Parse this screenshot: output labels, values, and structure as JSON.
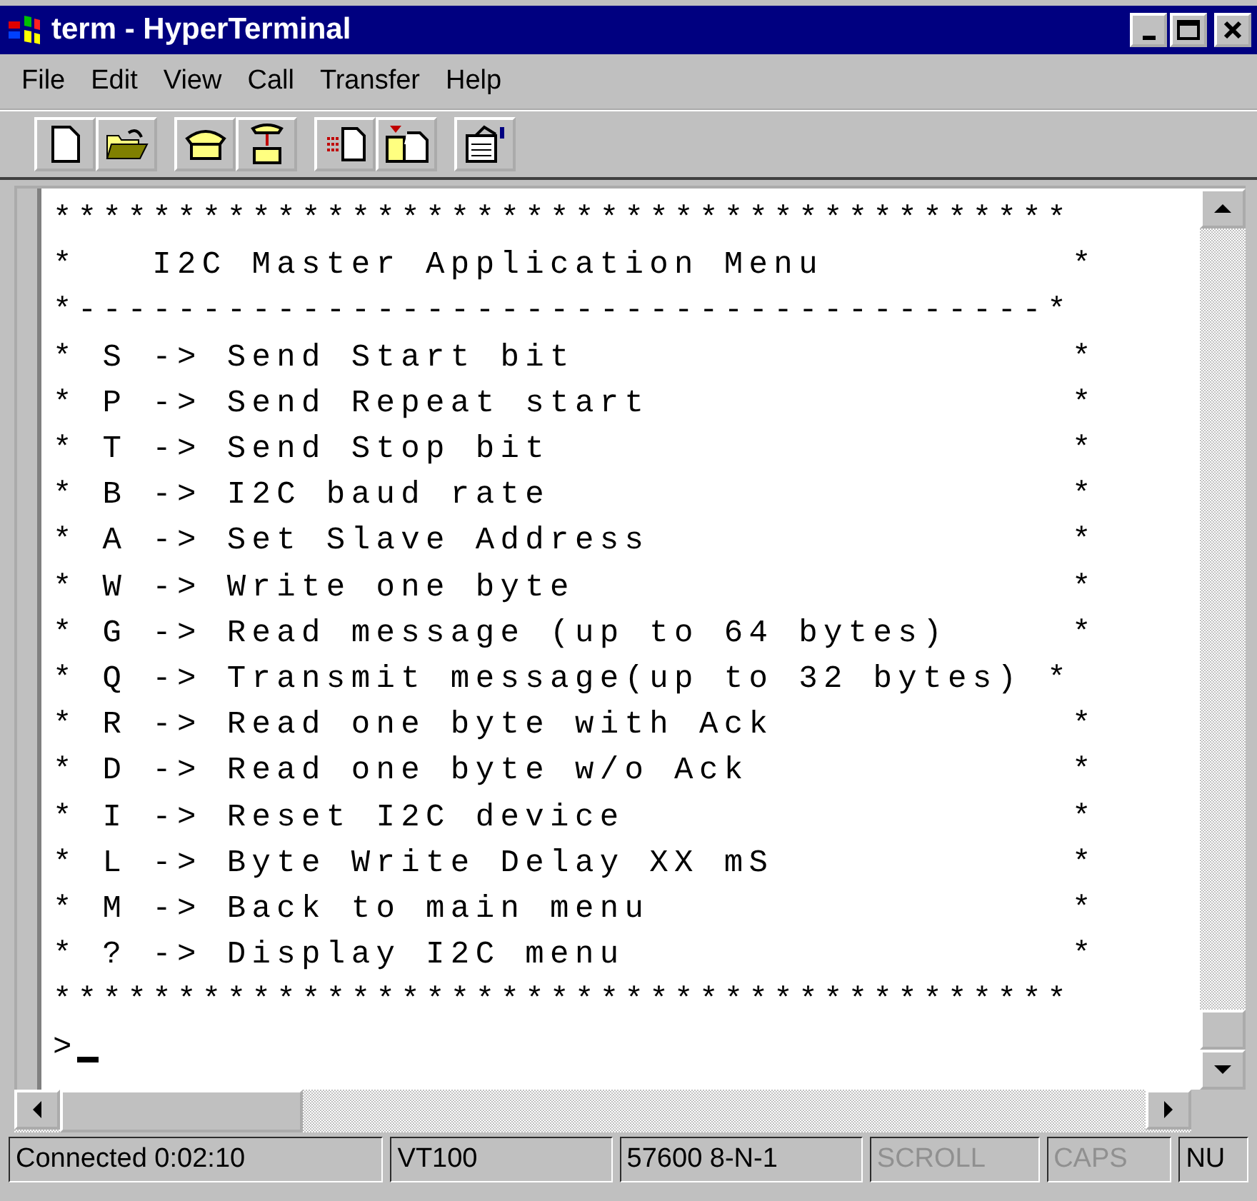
{
  "window": {
    "title": "term - HyperTerminal"
  },
  "menu": [
    "File",
    "Edit",
    "View",
    "Call",
    "Transfer",
    "Help"
  ],
  "toolbar": [
    {
      "kind": "new"
    },
    {
      "kind": "open"
    },
    {
      "kind": "gap"
    },
    {
      "kind": "call"
    },
    {
      "kind": "hangup"
    },
    {
      "kind": "gap"
    },
    {
      "kind": "send"
    },
    {
      "kind": "receive"
    },
    {
      "kind": "gap"
    },
    {
      "kind": "properties"
    }
  ],
  "terminal": {
    "lines": [
      "*****************************************",
      "*   I2C Master Application Menu          *",
      "*---------------------------------------*",
      "* S -> Send Start bit                    *",
      "* P -> Send Repeat start                 *",
      "* T -> Send Stop bit                     *",
      "* B -> I2C baud rate                     *",
      "* A -> Set Slave Address                 *",
      "* W -> Write one byte                    *",
      "* G -> Read message (up to 64 bytes)     *",
      "* Q -> Transmit message(up to 32 bytes) *",
      "* R -> Read one byte with Ack            *",
      "* D -> Read one byte w/o Ack             *",
      "* I -> Reset I2C device                  *",
      "* L -> Byte Write Delay XX mS            *",
      "* M -> Back to main menu                 *",
      "* ? -> Display I2C menu                  *",
      "*****************************************"
    ],
    "prompt": ">"
  },
  "status_bar": [
    {
      "text": "Connected 0:02:10",
      "disabled": false
    },
    {
      "text": "VT100",
      "disabled": false
    },
    {
      "text": "57600 8-N-1",
      "disabled": false
    },
    {
      "text": "SCROLL",
      "disabled": true
    },
    {
      "text": "CAPS",
      "disabled": true
    },
    {
      "text": "NU",
      "disabled": false
    }
  ]
}
